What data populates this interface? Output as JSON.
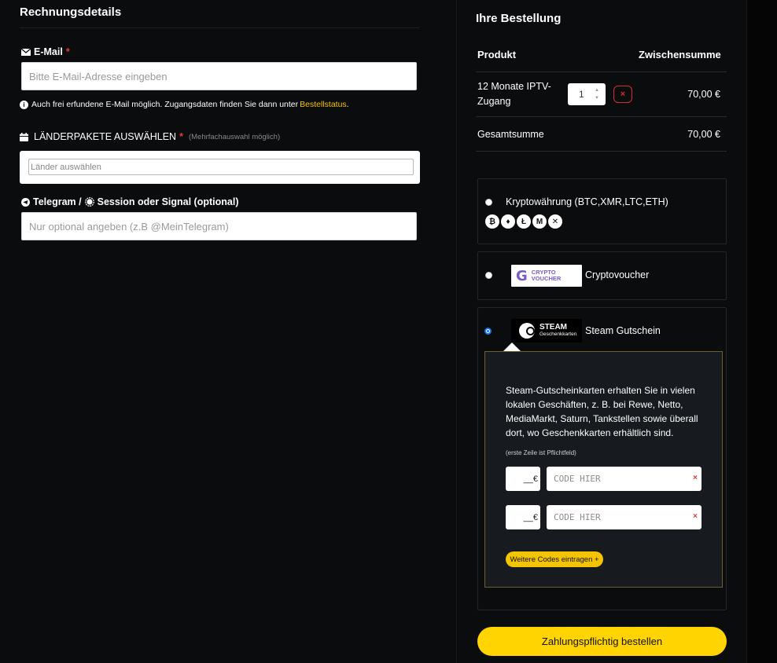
{
  "billing": {
    "title": "Rechnungsdetails",
    "email": {
      "label": "E-Mail",
      "required_mark": "*",
      "placeholder": "Bitte E-Mail-Adresse eingeben",
      "info_text": "Auch frei erfundene E-Mail möglich. Zugangsdaten finden Sie dann unter",
      "info_link": "Bestellstatus",
      "info_end": "."
    },
    "countries": {
      "label": "LÄNDERPAKETE AUSWÄHLEN",
      "required_mark": "*",
      "hint": "(Mehrfachauswahl möglich)",
      "placeholder": "Länder auswählen"
    },
    "messenger": {
      "label_a": "Telegram /",
      "label_b": "Session oder Signal (optional)",
      "placeholder": "Nur optional angeben (z.B @MeinTelegram)"
    }
  },
  "order": {
    "title": "Ihre Bestellung",
    "col_product": "Produkt",
    "col_subtotal": "Zwischensumme",
    "item": {
      "name": "12 Monate IPTV-Zugang",
      "quantity": "1",
      "price": "70,00 €",
      "remove_symbol": "×"
    },
    "total_label": "Gesamtsumme",
    "total_value": "70,00 €"
  },
  "payment": {
    "options": [
      {
        "label": "Kryptowährung (BTC,XMR,LTC,ETH)",
        "selected": false,
        "coins": [
          "₿",
          "♦",
          "Ł",
          "M",
          "✕"
        ]
      },
      {
        "label": "Cryptovoucher",
        "selected": false,
        "logo_text": "CRYPTO VOUCHER",
        "logo_mark": "G"
      },
      {
        "label": "Steam Gutschein",
        "selected": true,
        "logo_text": "STEAM",
        "logo_sub": "Geschenkkarten"
      }
    ],
    "steam_panel": {
      "description": "Steam-Gutscheinkarten erhalten Sie in vielen lokalen Geschäften, z. B. bei Rewe, Netto, MediaMarkt, Saturn, Tankstellen sowie überall dort, wo Geschenkkarten erhältlich sind.",
      "mandatory_note": "(erste Zeile ist Pflichtfeld)",
      "rows": [
        {
          "amount": "__€",
          "code_placeholder": "CODE HIER",
          "clear": "×"
        },
        {
          "amount": "__€",
          "code_placeholder": "CODE HIER",
          "clear": "×"
        }
      ],
      "more_button": "Weitere Codes eintragen +"
    }
  },
  "submit_label": "Zahlungspflichtig bestellen",
  "colors": {
    "accent": "#ffd400",
    "link": "#f5c400",
    "danger": "#d32f2f",
    "radio_selected": "#1a73e8"
  }
}
